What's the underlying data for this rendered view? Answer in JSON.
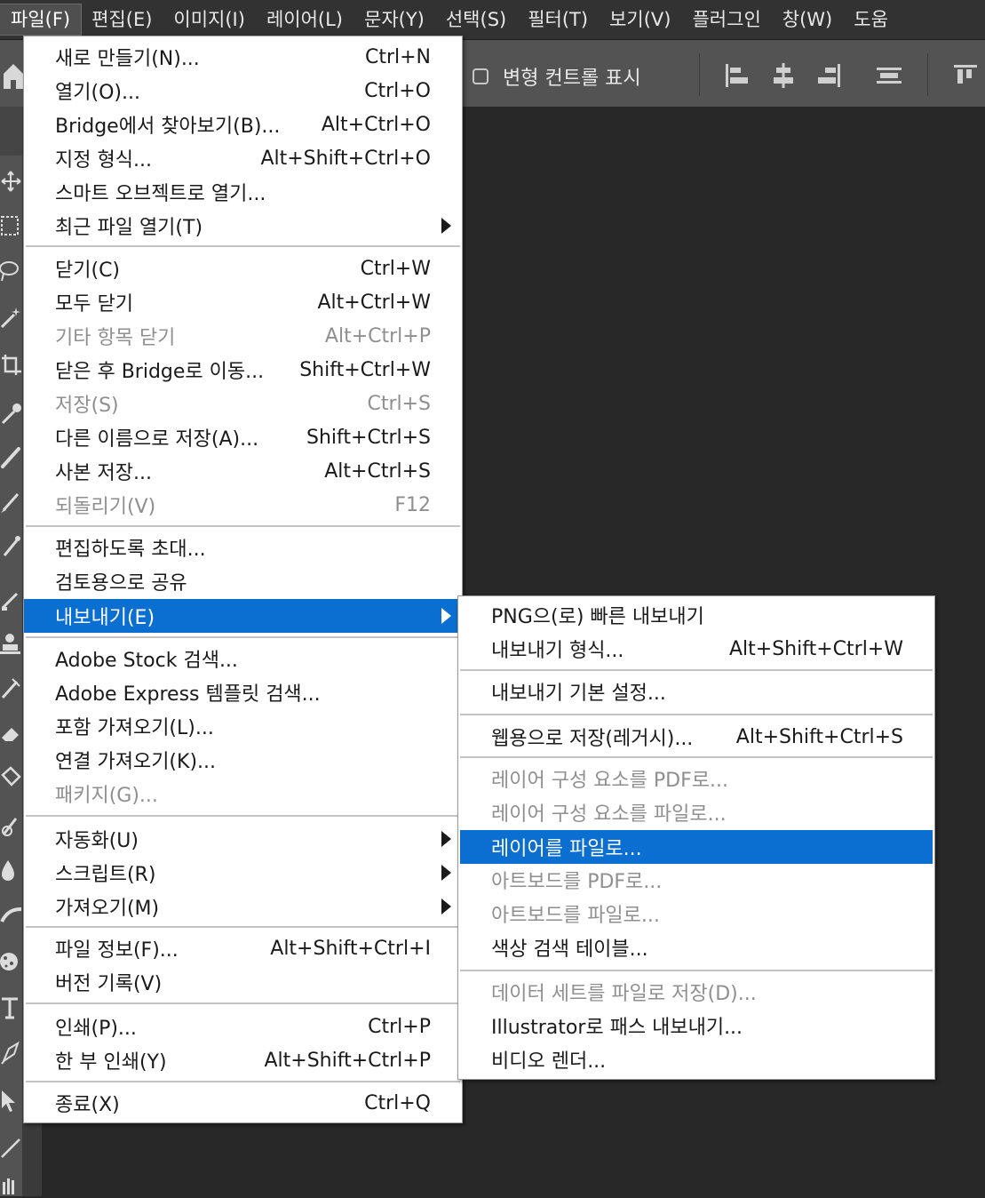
{
  "menubar": {
    "items": [
      {
        "label": "파일(F)",
        "active": true
      },
      {
        "label": "편집(E)"
      },
      {
        "label": "이미지(I)"
      },
      {
        "label": "레이어(L)"
      },
      {
        "label": "문자(Y)"
      },
      {
        "label": "선택(S)"
      },
      {
        "label": "필터(T)"
      },
      {
        "label": "보기(V)"
      },
      {
        "label": "플러그인"
      },
      {
        "label": "창(W)"
      },
      {
        "label": "도움"
      }
    ]
  },
  "options": {
    "transform_label": "변형 컨트롤 표시"
  },
  "file_menu": {
    "items": [
      {
        "label": "새로 만들기(N)...",
        "shortcut": "Ctrl+N"
      },
      {
        "label": "열기(O)...",
        "shortcut": "Ctrl+O"
      },
      {
        "label": "Bridge에서 찾아보기(B)...",
        "shortcut": "Alt+Ctrl+O"
      },
      {
        "label": "지정 형식...",
        "shortcut": "Alt+Shift+Ctrl+O"
      },
      {
        "label": "스마트 오브젝트로 열기...",
        "shortcut": ""
      },
      {
        "label": "최근 파일 열기(T)",
        "shortcut": "",
        "submenu": true
      },
      {
        "label": "닫기(C)",
        "shortcut": "Ctrl+W"
      },
      {
        "label": "모두 닫기",
        "shortcut": "Alt+Ctrl+W"
      },
      {
        "label": "기타 항목 닫기",
        "shortcut": "Alt+Ctrl+P",
        "disabled": true
      },
      {
        "label": "닫은 후 Bridge로 이동...",
        "shortcut": "Shift+Ctrl+W"
      },
      {
        "label": "저장(S)",
        "shortcut": "Ctrl+S",
        "disabled": true
      },
      {
        "label": "다른 이름으로 저장(A)...",
        "shortcut": "Shift+Ctrl+S"
      },
      {
        "label": "사본 저장...",
        "shortcut": "Alt+Ctrl+S"
      },
      {
        "label": "되돌리기(V)",
        "shortcut": "F12",
        "disabled": true
      },
      {
        "label": "편집하도록 초대...",
        "shortcut": ""
      },
      {
        "label": "검토용으로 공유",
        "shortcut": ""
      },
      {
        "label": "내보내기(E)",
        "shortcut": "",
        "submenu": true,
        "highlighted": true
      },
      {
        "label": "Adobe Stock 검색...",
        "shortcut": ""
      },
      {
        "label": "Adobe Express 템플릿 검색...",
        "shortcut": ""
      },
      {
        "label": "포함 가져오기(L)...",
        "shortcut": ""
      },
      {
        "label": "연결 가져오기(K)...",
        "shortcut": ""
      },
      {
        "label": "패키지(G)...",
        "shortcut": "",
        "disabled": true
      },
      {
        "label": "자동화(U)",
        "shortcut": "",
        "submenu": true
      },
      {
        "label": "스크립트(R)",
        "shortcut": "",
        "submenu": true
      },
      {
        "label": "가져오기(M)",
        "shortcut": "",
        "submenu": true
      },
      {
        "label": "파일 정보(F)...",
        "shortcut": "Alt+Shift+Ctrl+I"
      },
      {
        "label": "버전 기록(V)",
        "shortcut": ""
      },
      {
        "label": "인쇄(P)...",
        "shortcut": "Ctrl+P"
      },
      {
        "label": "한 부 인쇄(Y)",
        "shortcut": "Alt+Shift+Ctrl+P"
      },
      {
        "label": "종료(X)",
        "shortcut": "Ctrl+Q"
      }
    ]
  },
  "export_menu": {
    "items": [
      {
        "label": "PNG으(로) 빠른 내보내기",
        "shortcut": ""
      },
      {
        "label": "내보내기 형식...",
        "shortcut": "Alt+Shift+Ctrl+W"
      },
      {
        "label": "내보내기 기본 설정...",
        "shortcut": ""
      },
      {
        "label": "웹용으로 저장(레거시)...",
        "shortcut": "Alt+Shift+Ctrl+S"
      },
      {
        "label": "레이어 구성 요소를 PDF로...",
        "shortcut": "",
        "disabled": true
      },
      {
        "label": "레이어 구성 요소를 파일로...",
        "shortcut": "",
        "disabled": true
      },
      {
        "label": "레이어를 파일로...",
        "shortcut": "",
        "highlighted": true
      },
      {
        "label": "아트보드를 PDF로...",
        "shortcut": "",
        "disabled": true
      },
      {
        "label": "아트보드를 파일로...",
        "shortcut": "",
        "disabled": true
      },
      {
        "label": "색상 검색 테이블...",
        "shortcut": ""
      },
      {
        "label": "데이터 세트를 파일로 저장(D)...",
        "shortcut": "",
        "disabled": true
      },
      {
        "label": "Illustrator로 패스 내보내기...",
        "shortcut": ""
      },
      {
        "label": "비디오 렌더...",
        "shortcut": ""
      }
    ]
  },
  "colors": {
    "highlight": "#0a6fd1",
    "app_bg": "#282828",
    "menubar_bg": "#323232",
    "panel_bg": "#535353"
  }
}
